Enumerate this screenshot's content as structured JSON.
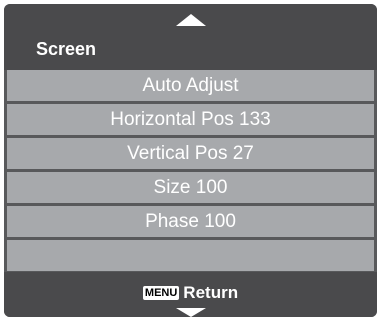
{
  "header": {
    "title": "Screen",
    "up_icon": "triangle-up-icon"
  },
  "menu": {
    "items": [
      {
        "label": "Auto Adjust"
      },
      {
        "label": "Horizontal Pos 133"
      },
      {
        "label": "Vertical Pos 27"
      },
      {
        "label": "Size 100"
      },
      {
        "label": "Phase 100"
      },
      {
        "label": ""
      }
    ]
  },
  "footer": {
    "key_label": "MENU",
    "return_label": "Return",
    "down_icon": "triangle-down-icon"
  },
  "colors": {
    "panel": "#58595b",
    "header_bg": "#4a4a4c",
    "item_bg": "#a7a9ac",
    "text": "#ffffff"
  }
}
